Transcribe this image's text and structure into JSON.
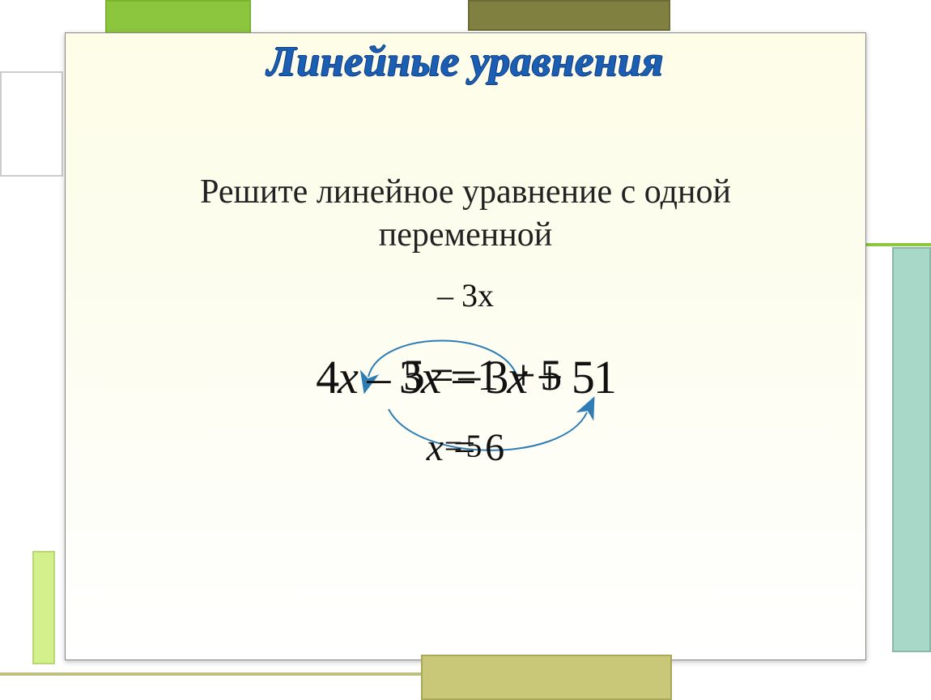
{
  "title": "Линейные уравнения",
  "subtitle_line1": "Решите линейное уравнение с одной",
  "subtitle_line2": "переменной",
  "math": {
    "above": "– 3x",
    "main": "4x – 3x = 3x + 51",
    "main_overlay": "5 = –1  + 5",
    "result": "x = 6",
    "result_overlay": "= 5"
  },
  "arrows": {
    "color": "#2e7db4"
  }
}
